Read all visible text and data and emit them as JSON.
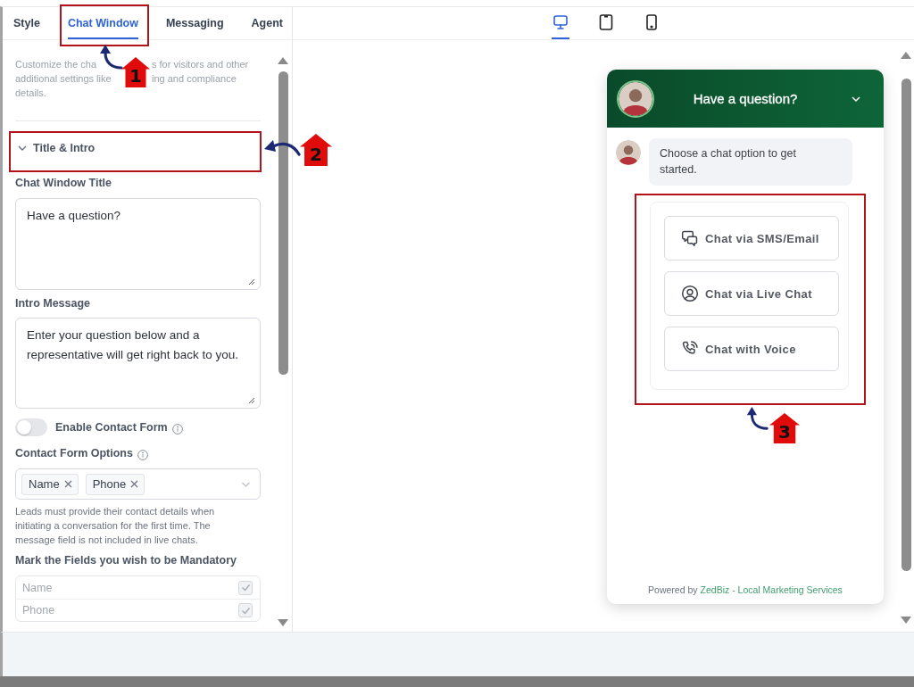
{
  "tabs": [
    {
      "label": "Style",
      "selected": false
    },
    {
      "label": "Chat Window",
      "selected": true
    },
    {
      "label": "Messaging",
      "selected": false
    },
    {
      "label": "Agent",
      "selected": false
    }
  ],
  "description": {
    "lines": [
      [
        "Customize the cha",
        "s for visitors and other"
      ],
      [
        "additional settings like",
        "ing and compliance"
      ],
      [
        "details."
      ]
    ]
  },
  "section": {
    "title": "Title & Intro",
    "expanded": true
  },
  "fields": [
    {
      "label": "Chat Window Title",
      "value": "Have a question?"
    },
    {
      "label": "Intro Message",
      "value": "Enter your question below and a representative will get right back to you."
    }
  ],
  "contact_form_toggle": {
    "label": "Enable Contact Form",
    "on": false
  },
  "contact_form_options": {
    "label": "Contact Form Options",
    "tags": [
      "Name",
      "Phone"
    ],
    "help": "Leads must provide their contact details when initiating a conversation for the first time. The message field is not included in live chats."
  },
  "mandatory": {
    "label": "Mark the Fields you wish to be Mandatory",
    "rows": [
      {
        "label": "Name",
        "checked": true,
        "disabled": true
      },
      {
        "label": "Phone",
        "checked": true,
        "disabled": true
      }
    ]
  },
  "device_tabs": [
    {
      "kind": "desktop",
      "selected": true
    },
    {
      "kind": "tablet",
      "selected": false
    },
    {
      "kind": "mobile",
      "selected": false
    }
  ],
  "chat_widget": {
    "title": "Have a question?",
    "message": "Choose a chat option to get started.",
    "options": [
      {
        "kind": "sms",
        "label": "Chat via SMS/Email"
      },
      {
        "kind": "live",
        "label": "Chat via Live Chat"
      },
      {
        "kind": "voice",
        "label": "Chat with Voice"
      }
    ],
    "footer": {
      "text": "Powered by",
      "link": "ZedBiz - Local Marketing Services"
    }
  },
  "annotations": [
    {
      "number": "1"
    },
    {
      "number": "2"
    },
    {
      "number": "3"
    }
  ]
}
